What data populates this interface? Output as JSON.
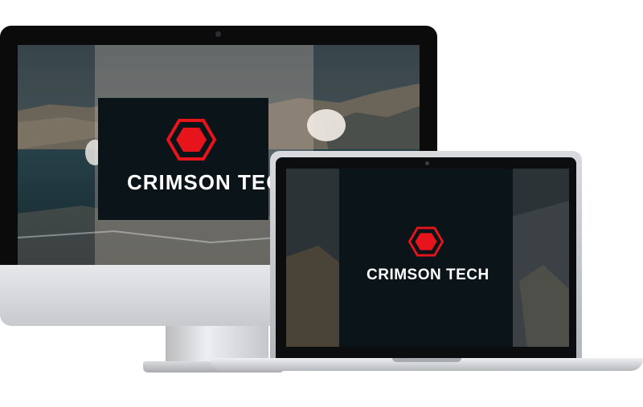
{
  "desktop_screen": {
    "brand": "CRIMSON TECH",
    "logo_icon": "hexagon-icon",
    "panel_color": "#0b1419",
    "accent_color": "#e8141b"
  },
  "laptop_screen": {
    "brand": "CRIMSON TECH",
    "logo_icon": "hexagon-icon",
    "panel_color": "#0b1419",
    "accent_color": "#e8141b"
  }
}
